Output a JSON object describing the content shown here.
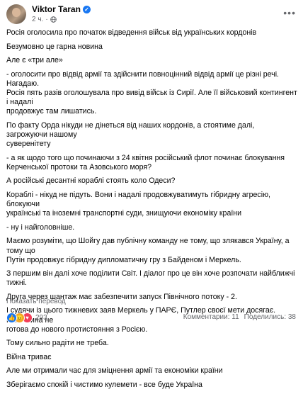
{
  "post": {
    "author": "Viktor Taran",
    "time": "2 ч.",
    "time_separator": "·",
    "paragraphs": [
      "Росія оголосила про початок відведення військ від українських кордонів",
      "Безумовно це гарна новина",
      "Але є «три але»",
      "- оголосити про відвід армії та здійснити повноцінний відвід армії це різні речі. Нагадаю.\nРосія пять разів оголошувала про вивід військ із Сирії. Але її військовий контингент і надалі\nпродовжує там лишатись.",
      "По факту Орда нікуди не дінеться від наших кордонів, а стоятиме далі, загрожуючи нашому\nсуверенітету",
      "- а як щодо того що починаючи з 24 квітня російський флот починає блокування\nКерченської протоки та Азовського моря?",
      "А російські десантні кораблі стоять коло Одеси?",
      "Кораблі - нікуд не підуть. Вони і надалі продовжуватимуть гібридну агресію, блокуючи\nукраїнські та іноземні транспортні суди, знищуючи економіку країни",
      "- ну і найголовніше.",
      "Маємо розуміти, що Шойгу дав публічну команду не тому, що злякався Україну, а тому що\nПутін продовжує гібридну дипломатичну гру з Байденом і Меркель.",
      "З першим він далі хоче поділити Світ. І діалог про це він хоче розпочати найближчі тижні.",
      "Друга через шантаж має забезпечити запуск Північного потоку - 2.",
      "І судячи із цього тижневих заяв Меркель у ПАРЄ, Путлер своєї мети досягає. Німеччина не\nготова до нового протистояння з Росією.",
      "Тому сильно радіти не треба.",
      "Війна триває",
      "Але ми отримали час для зміцнення армії та економіки країни",
      "Зберігаємо спокій і чистимо кулемети - все буде Україна"
    ],
    "translate_link": "Показать перевод",
    "reactions_count": "293",
    "comments": "Комментарии: 11",
    "shares": "Поделились: 38"
  },
  "icons": {
    "more": "ellipsis-icon",
    "privacy": "globe-icon",
    "verified": "verified-badge-icon",
    "reactions": [
      "like-icon",
      "angry-icon",
      "love-icon"
    ]
  },
  "colors": {
    "accent": "#1877f2",
    "secondary_text": "#65676b",
    "text": "#050505"
  }
}
